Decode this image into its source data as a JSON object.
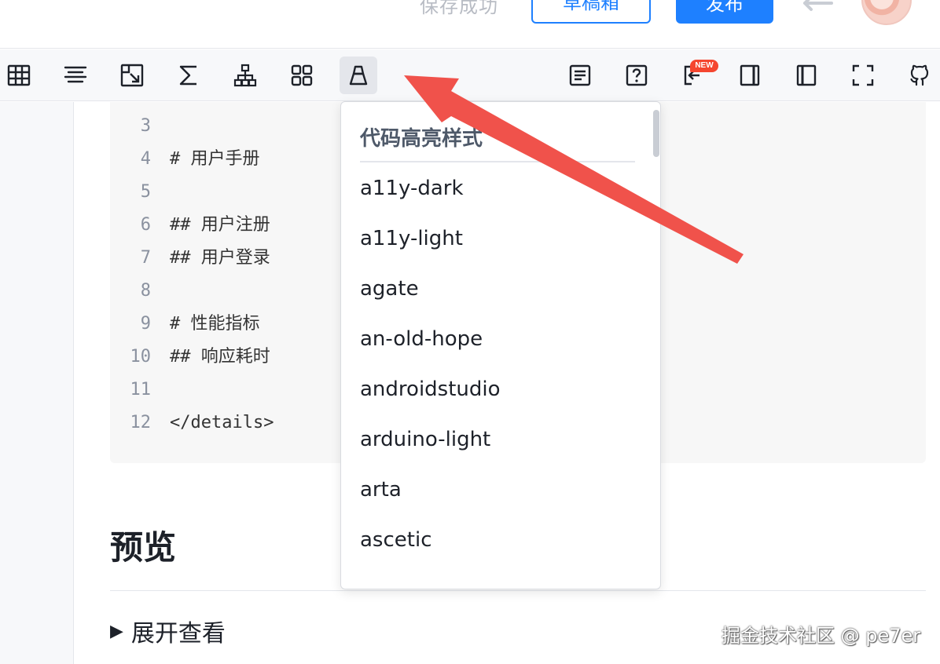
{
  "header": {
    "save_status": "保存成功",
    "draft_button": "草稿箱",
    "publish_button": "发布"
  },
  "toolbar": {
    "icons": [
      "table-icon",
      "align-icon",
      "insert-image-icon",
      "formula-icon",
      "diagram-icon",
      "grid-icon",
      "code-theme-icon",
      "contents-icon",
      "help-icon",
      "import-icon",
      "preview-panel-icon",
      "sidebar-icon",
      "fullscreen-icon",
      "github-icon"
    ],
    "new_badge": "NEW"
  },
  "code": {
    "lines": [
      {
        "num": "3",
        "text": ""
      },
      {
        "num": "4",
        "text": "# 用户手册"
      },
      {
        "num": "5",
        "text": ""
      },
      {
        "num": "6",
        "text": "## 用户注册"
      },
      {
        "num": "7",
        "text": "## 用户登录"
      },
      {
        "num": "8",
        "text": ""
      },
      {
        "num": "9",
        "text": "# 性能指标"
      },
      {
        "num": "10",
        "text": "## 响应耗时"
      },
      {
        "num": "11",
        "text": ""
      },
      {
        "num": "12",
        "text": "</details>"
      }
    ]
  },
  "preview": {
    "title": "预览",
    "summary": "展开查看",
    "summary_marker": "▶"
  },
  "dropdown": {
    "title": "代码高亮样式",
    "items": [
      "a11y-dark",
      "a11y-light",
      "agate",
      "an-old-hope",
      "androidstudio",
      "arduino-light",
      "arta",
      "ascetic"
    ]
  },
  "watermark": "掘金技术社区 @ pe7er",
  "colors": {
    "accent": "#1e80ff",
    "annotation_arrow": "#f0524b",
    "badge": "#f5462f"
  }
}
